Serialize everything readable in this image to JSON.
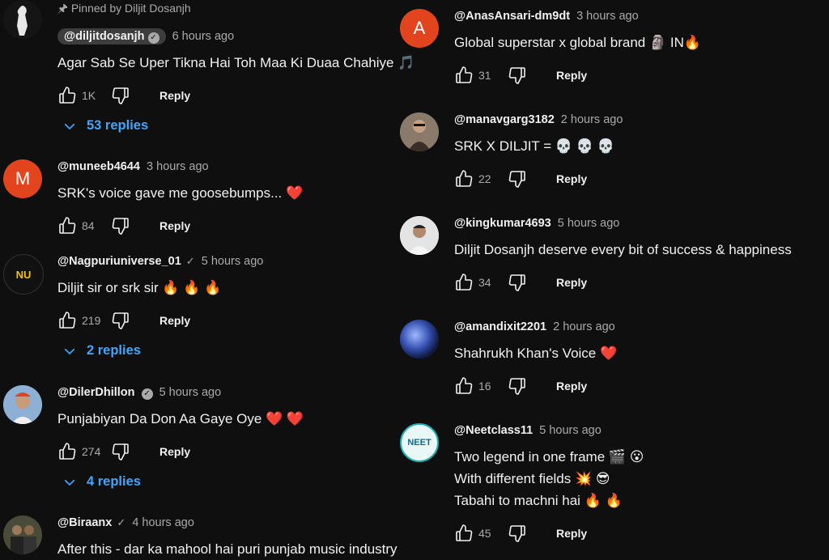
{
  "left_column": [
    {
      "pinned_text": "Pinned by Diljit Dosanjh",
      "author": "@diljitdosanjh",
      "time": "6 hours ago",
      "lines": [
        "Agar Sab Se Uper Tikna Hai Toh Maa Ki Duaa Chahiye 🎵"
      ],
      "likes": "1K",
      "reply_label": "Reply",
      "replies_label": "53 replies"
    },
    {
      "author": "@muneeb4644",
      "time": "3 hours ago",
      "avatar_letter": "M",
      "lines": [
        "SRK's voice gave me goosebumps... ❤️"
      ],
      "likes": "84",
      "reply_label": "Reply"
    },
    {
      "author": "@Nagpuriuniverse_01",
      "time": "5 hours ago",
      "avatar_letter": "NU",
      "lines": [
        "Diljit sir or srk sir 🔥 🔥 🔥"
      ],
      "likes": "219",
      "reply_label": "Reply",
      "replies_label": "2 replies"
    },
    {
      "author": "@DilerDhillon",
      "time": "5 hours ago",
      "lines": [
        "Punjabiyan Da Don Aa Gaye Oye ❤️ ❤️"
      ],
      "likes": "274",
      "reply_label": "Reply",
      "replies_label": "4 replies"
    },
    {
      "author": "@Biraanx",
      "time": "4 hours ago",
      "lines": [
        "After this - dar ka mahool hai puri punjab music industry"
      ]
    }
  ],
  "right_column": [
    {
      "author": "@AnasAnsari-dm9dt",
      "time": "3 hours ago",
      "avatar_letter": "A",
      "lines": [
        "Global superstar x global brand 🗿 IN🔥"
      ],
      "likes": "31",
      "reply_label": "Reply"
    },
    {
      "author": "@manavgarg3182",
      "time": "2 hours ago",
      "lines": [
        "SRK X DILJIT = 💀 💀 💀"
      ],
      "likes": "22",
      "reply_label": "Reply"
    },
    {
      "author": "@kingkumar4693",
      "time": "5 hours ago",
      "lines": [
        "Diljit Dosanjh deserve every bit of success & happiness"
      ],
      "likes": "34",
      "reply_label": "Reply"
    },
    {
      "author": "@amandixit2201",
      "time": "2 hours ago",
      "lines": [
        "Shahrukh Khan's Voice ❤️"
      ],
      "likes": "16",
      "reply_label": "Reply"
    },
    {
      "author": "@Neetclass11",
      "time": "5 hours ago",
      "avatar_letter": "NEET",
      "lines": [
        "Two legend in one frame 🎬 😮",
        "With different fields 💥 😎",
        "Tabahi to machni hai 🔥 🔥"
      ],
      "likes": "45",
      "reply_label": "Reply"
    }
  ],
  "colors": {
    "background": "#0f0f0f",
    "text": "#f1f1f1",
    "muted": "#aaaaaa",
    "link": "#3ea6ff",
    "avatar_m": "#e2451d",
    "avatar_a": "#e2451d"
  }
}
